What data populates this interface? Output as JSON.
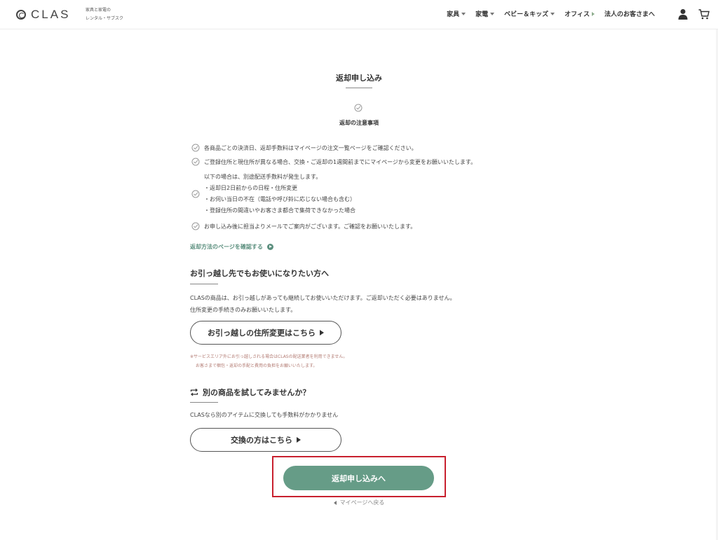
{
  "header": {
    "logo": "CLAS",
    "tagline": [
      "家具と家電の",
      "レンタル・サブスク"
    ],
    "nav": [
      {
        "label": "家具",
        "marker": "down"
      },
      {
        "label": "家電",
        "marker": "down"
      },
      {
        "label": "ベビー＆キッズ",
        "marker": "down"
      },
      {
        "label": "オフィス",
        "marker": "right"
      },
      {
        "label": "法人のお客さまへ",
        "marker": "none"
      }
    ],
    "icons": [
      "user-icon",
      "cart-icon"
    ]
  },
  "main": {
    "title": "返却申し込み",
    "notice_heading": "返却の注意事項",
    "notes": [
      "各商品ごとの決済日、返却手数料はマイページの注文一覧ページをご確認ください。",
      "ご登録住所と現住所が異なる場合、交換・ご返却の1週間前までにマイページから変更をお願いいたします。"
    ],
    "fee_note": [
      "以下の場合は、別途配送手数料が発生します。",
      "・返却日2日前からの日程・住所変更",
      "・お伺い当日の不在（電話や呼び鈴に応じない場合も含む）",
      "・登録住所の間違いやお客さま都合で集荷できなかった場合"
    ],
    "mail_note": "お申し込み後に担当よりメールでご案内がございます。ご確認をお願いいたします。",
    "method_link": "返却方法のページを確認する",
    "moving": {
      "heading": "お引っ越し先でもお使いになりたい方へ",
      "body": [
        "CLASの商品は、お引っ越しがあっても継続してお使いいただけます。ご返却いただく必要はありません。",
        "住所変更の手続きのみお願いいたします。"
      ],
      "button": "お引っ越しの住所変更はこちら",
      "warning": [
        "※サービスエリア外にお引っ越しされる場合はCLASの配送業者を利用できません。",
        "お客さまで梱包・返却の手配と費用の負担をお願いいたします。"
      ]
    },
    "exchange": {
      "heading": "別の商品を試してみませんか？",
      "body": "CLASなら別のアイテムに交換しても手数料がかかりません",
      "button": "交換の方はこちら"
    },
    "primary_button": "返却申し込みへ",
    "back_link": "マイページへ戻る"
  },
  "colors": {
    "accent": "#669c87",
    "link": "#5b8f7e",
    "warning": "#b27a72",
    "highlight": "#c8202e"
  }
}
